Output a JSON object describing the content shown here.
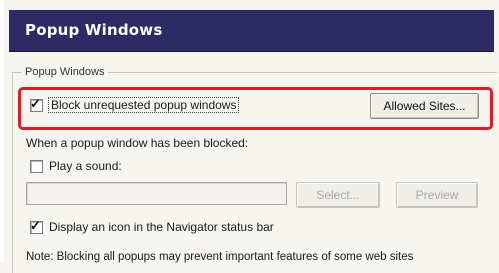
{
  "header": {
    "title": "Popup Windows"
  },
  "group": {
    "legend": "Popup Windows"
  },
  "block_popups": {
    "label": "Block unrequested popup windows",
    "checked": true,
    "check_glyph": "✓"
  },
  "allowed_sites_button": {
    "label": "Allowed Sites..."
  },
  "when_blocked": {
    "text": "When a popup window has been blocked:"
  },
  "play_sound": {
    "label": "Play a sound:",
    "checked": false
  },
  "sound_file": {
    "value": ""
  },
  "select_button": {
    "label": "Select..."
  },
  "preview_button": {
    "label": "Preview"
  },
  "show_icon": {
    "label": "Display an icon in the Navigator status bar",
    "checked": true,
    "check_glyph": "✓"
  },
  "note": {
    "text": "Note: Blocking all popups may prevent important features of some web sites"
  },
  "colors": {
    "header_bg": "#2e2a66",
    "highlight": "#d9202a"
  }
}
